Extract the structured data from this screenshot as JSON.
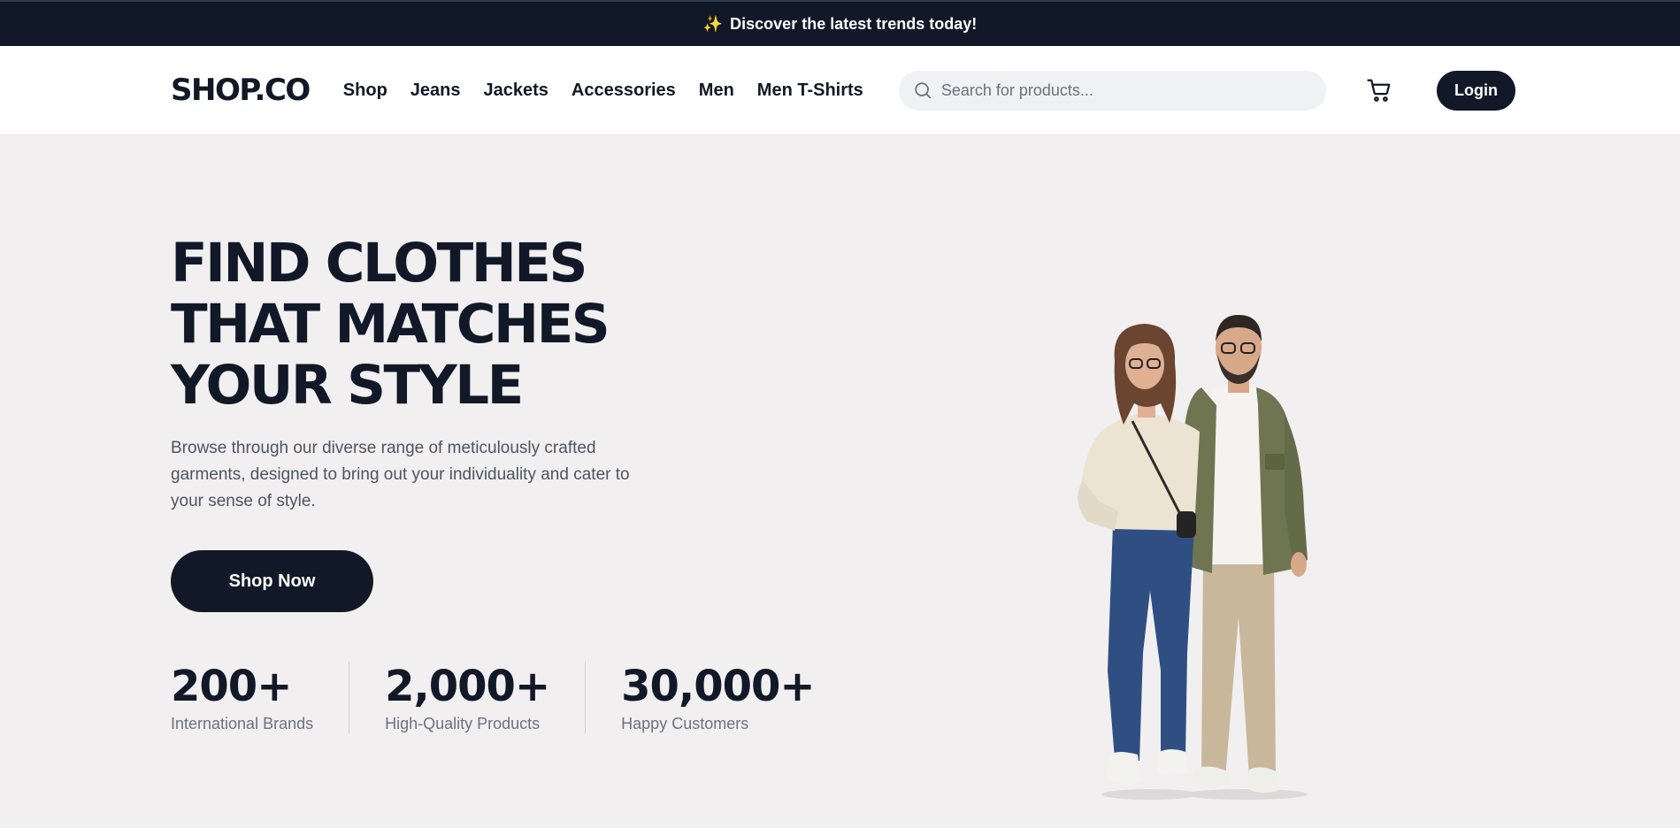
{
  "announcement": {
    "icon": "sparkles-icon",
    "text": "Discover the latest trends today!"
  },
  "header": {
    "logo": "SHOP.CO",
    "nav": [
      "Shop",
      "Jeans",
      "Jackets",
      "Accessories",
      "Men",
      "Men T-Shirts"
    ],
    "search": {
      "placeholder": "Search for products...",
      "value": ""
    },
    "cart_icon": "cart-icon",
    "login_label": "Login"
  },
  "hero": {
    "headline": "FIND CLOTHES THAT MATCHES YOUR STYLE",
    "description": "Browse through our diverse range of meticulously crafted garments, designed to bring out your individuality and cater to your sense of style.",
    "cta_label": "Shop Now",
    "stats": [
      {
        "value": "200+",
        "label": "International Brands"
      },
      {
        "value": "2,000+",
        "label": "High-Quality Products"
      },
      {
        "value": "30,000+",
        "label": "Happy Customers"
      }
    ]
  },
  "colors": {
    "primary": "#111827",
    "background": "#f1eff0",
    "muted_text": "#6b7280"
  }
}
